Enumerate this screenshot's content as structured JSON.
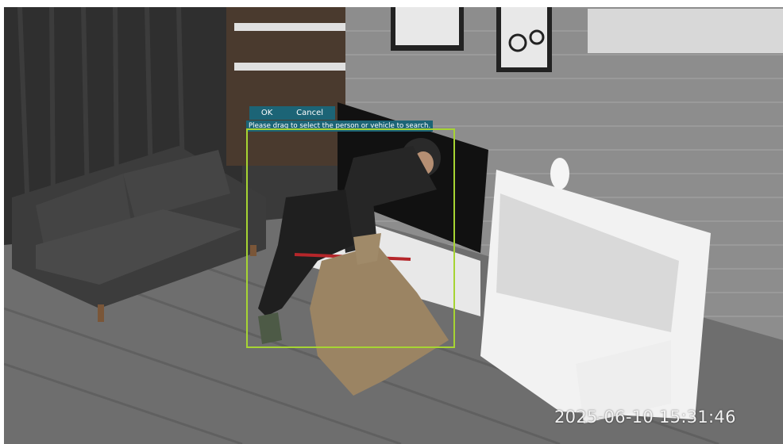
{
  "camera": {
    "timestamp": "2025-06-10 15:31:46"
  },
  "selection_toolbar": {
    "ok_label": "OK",
    "cancel_label": "Cancel",
    "hint": "Please drag to select the person or vehicle to search."
  },
  "colors": {
    "toolbar_bg": "#1c6476",
    "selection_border": "#a6d433",
    "timestamp_text": "#f2f2f2"
  }
}
